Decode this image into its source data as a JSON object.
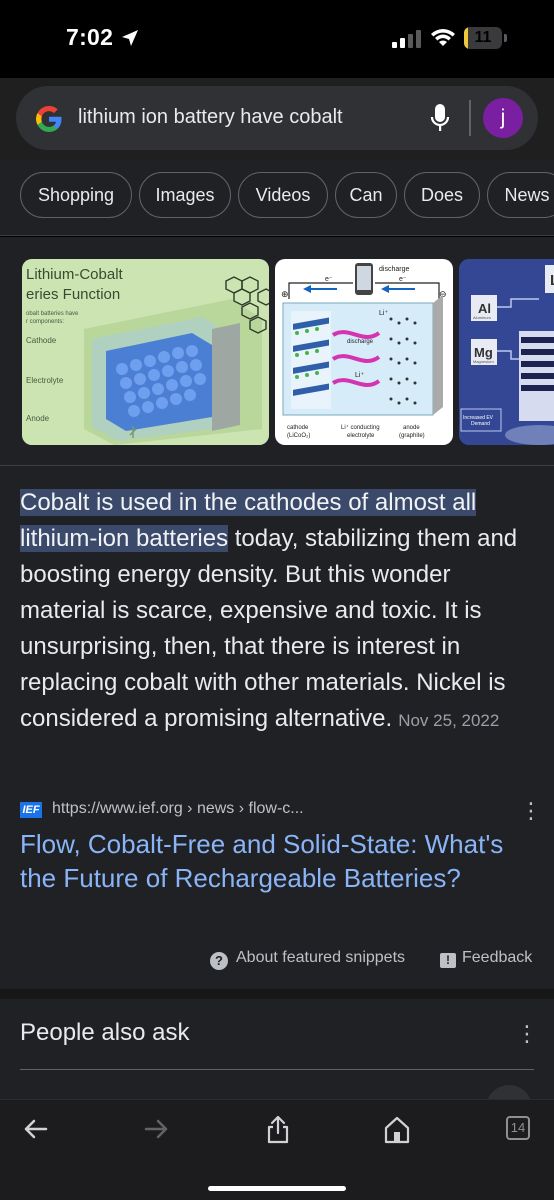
{
  "status_bar": {
    "time": "7:02",
    "battery_level": "11",
    "battery_fraction": 0.11
  },
  "search": {
    "query": "lithium ion battery have cobalt",
    "avatar_letter": "j"
  },
  "chips": [
    {
      "label": "Shopping"
    },
    {
      "label": "Images"
    },
    {
      "label": "Videos"
    },
    {
      "label": "Can"
    },
    {
      "label": "Does"
    },
    {
      "label": "News"
    }
  ],
  "images": {
    "first": {
      "title_line1": "Lithium-Cobalt",
      "title_line2": "eries Function",
      "subtitle1": "obalt batteries have",
      "subtitle2": "r components:",
      "label_cathode": "Cathode",
      "label_electrolyte": "Electrolyte",
      "label_anode": "Anode"
    },
    "second": {
      "discharge_top": "discharge",
      "discharge_mid": "discharge",
      "e_left": "e⁻",
      "e_right": "e⁻",
      "li_top": "Li⁺",
      "li_mid": "Li⁺",
      "plus": "⊕",
      "minus": "⊖",
      "cathode": "cathode",
      "cathode_formula": "(LiCoO₂)",
      "electrolyte1": "Li⁺ conducting",
      "electrolyte2": "electrolyte",
      "anode": "anode",
      "anode_formula": "(graphite)"
    },
    "third": {
      "al_symbol": "Al",
      "al_name": "Aluminum",
      "mg_symbol": "Mg",
      "mg_name": "Magnesium",
      "demand1": "Increased EV",
      "demand2": "Demand",
      "partial": "L"
    }
  },
  "featured_snippet": {
    "highlight": "Cobalt is used in the cathodes of almost all lithium-ion batteries",
    "body": " today, stabilizing them and boosting energy density. But this wonder material is scarce, expensive and toxic. It is unsurprising, then, that there is interest in replacing cobalt with other materials. Nickel is considered a promising alternative.",
    "date": "Nov 25, 2022"
  },
  "source": {
    "favicon_text": "IEF",
    "url": "https://www.ief.org › news › flow-c...",
    "title": "Flow, Cobalt-Free and Solid-State: What's the Future of Rechargeable Batteries?"
  },
  "snippet_links": {
    "about": "About featured snippets",
    "feedback": "Feedback"
  },
  "people_also_ask": {
    "title": "People also ask"
  },
  "toolbar": {
    "tabs_count": "14"
  },
  "colors": {
    "background": "#202124",
    "link": "#8ab4f8",
    "highlight": "#3b4a6b",
    "avatar": "#7b1fa2",
    "battery": "#f0c93a"
  }
}
